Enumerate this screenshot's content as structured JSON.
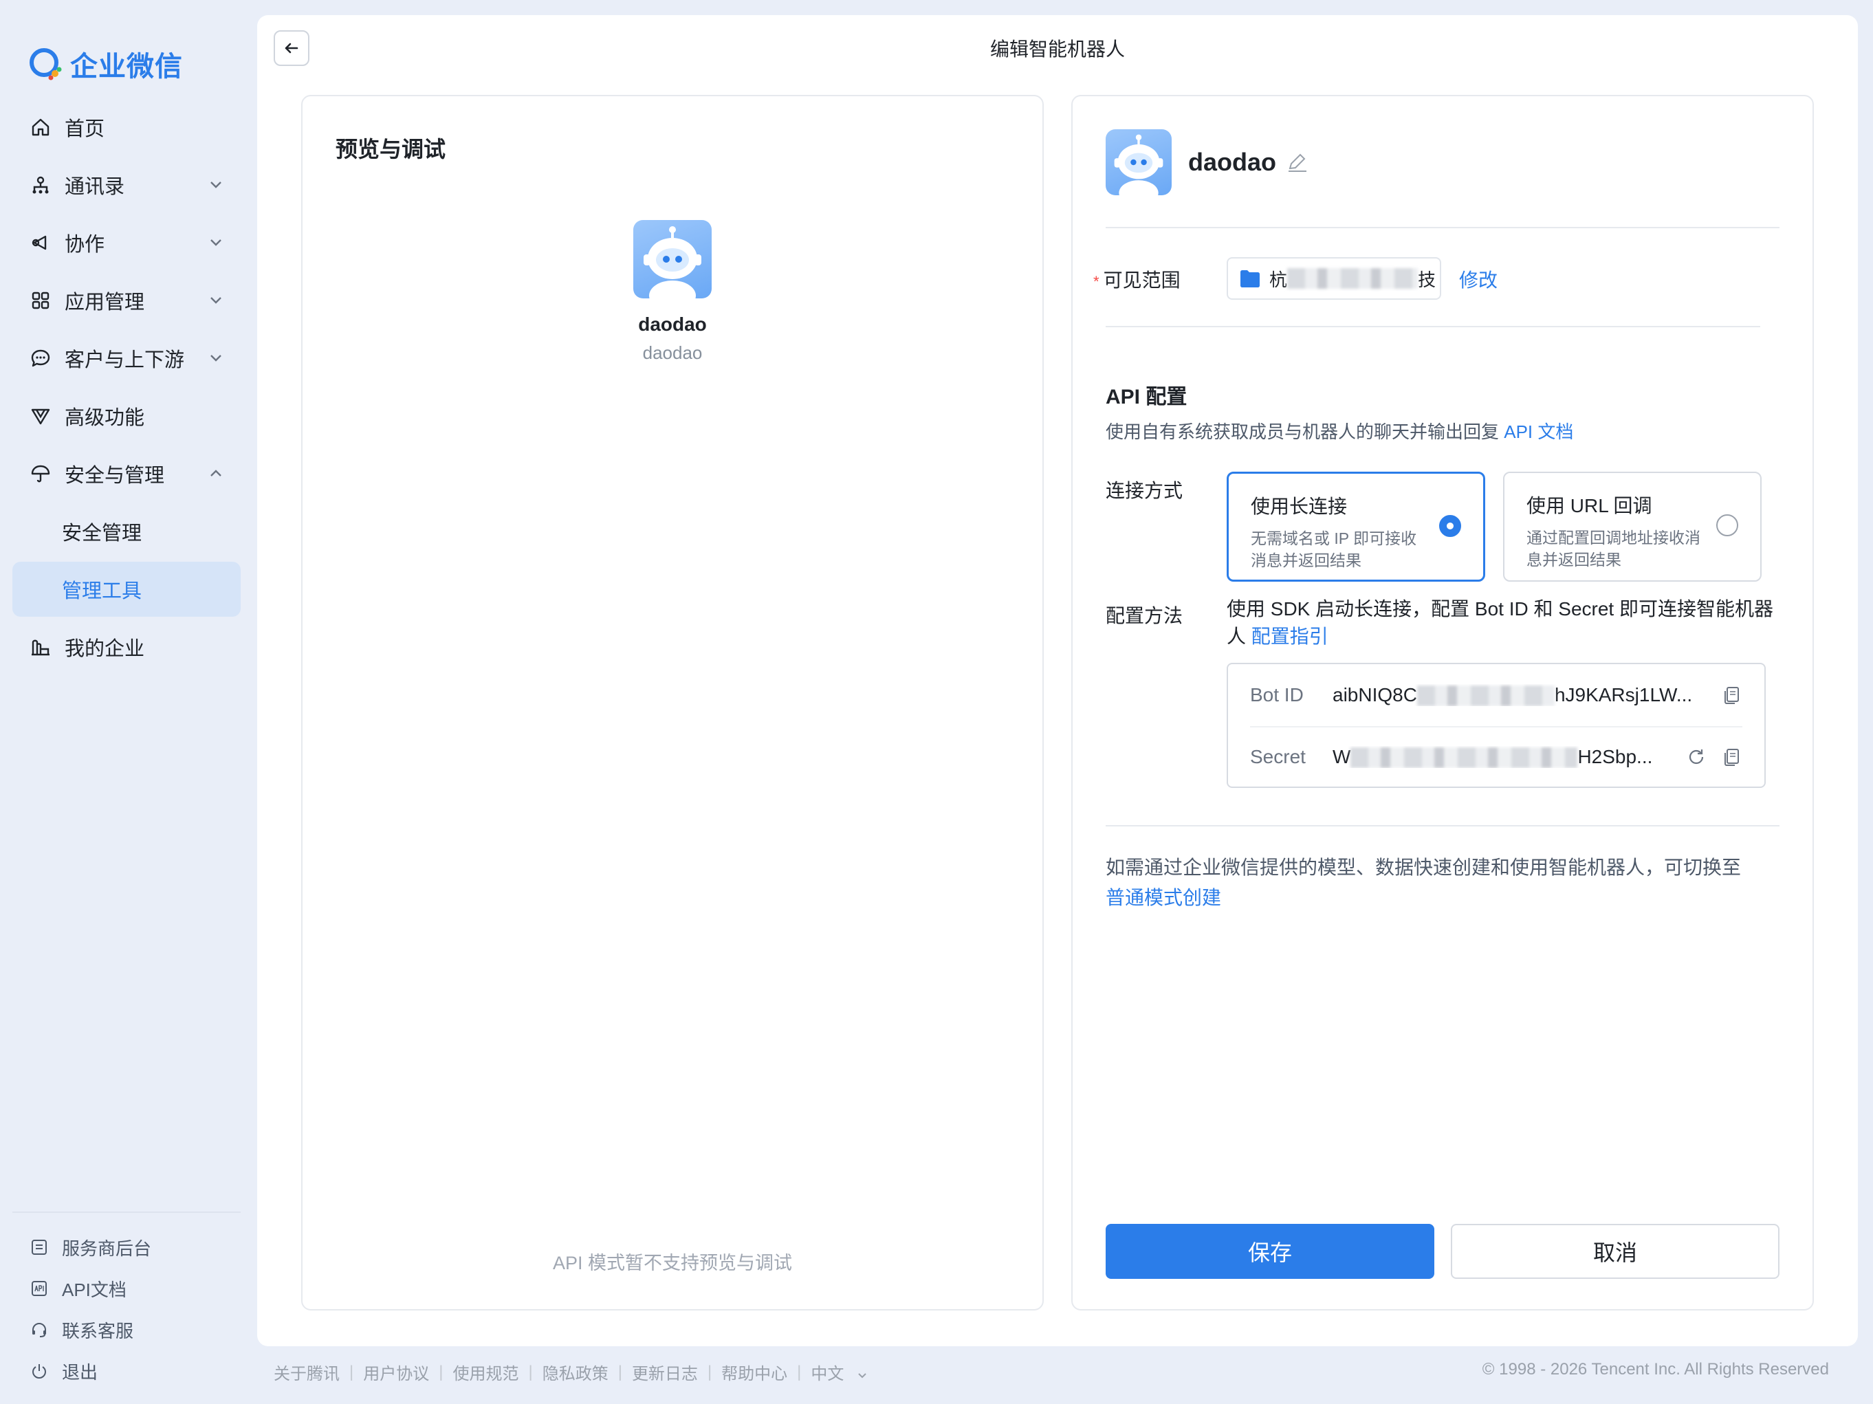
{
  "app": {
    "name": "企业微信",
    "brand_color": "#2b7de9"
  },
  "sidebar": {
    "items": [
      {
        "label": "首页",
        "icon": "home-icon"
      },
      {
        "label": "通讯录",
        "icon": "org-chart-icon",
        "expand": "chevron-down"
      },
      {
        "label": "协作",
        "icon": "collab-icon",
        "expand": "chevron-down"
      },
      {
        "label": "应用管理",
        "icon": "apps-grid-icon",
        "expand": "chevron-down"
      },
      {
        "label": "客户与上下游",
        "icon": "chat-bubble-icon",
        "expand": "chevron-down"
      },
      {
        "label": "高级功能",
        "icon": "advanced-icon"
      },
      {
        "label": "安全与管理",
        "icon": "umbrella-icon",
        "expand": "chevron-up"
      },
      {
        "label": "安全管理",
        "sub": true
      },
      {
        "label": "管理工具",
        "sub": true,
        "active": true
      },
      {
        "label": "我的企业",
        "icon": "buildings-icon"
      }
    ],
    "bottom": [
      {
        "label": "服务商后台",
        "icon": "provider-icon"
      },
      {
        "label": "API文档",
        "icon": "api-doc-icon"
      },
      {
        "label": "联系客服",
        "icon": "headset-icon"
      },
      {
        "label": "退出",
        "icon": "power-icon"
      }
    ]
  },
  "header": {
    "title": "编辑智能机器人"
  },
  "preview": {
    "title": "预览与调试",
    "bot_name": "daodao",
    "bot_sub": "daodao",
    "note": "API 模式暂不支持预览与调试"
  },
  "config": {
    "bot_name": "daodao",
    "scope_label": "可见范围",
    "scope_value_start": "杭",
    "scope_value_end": "技",
    "scope_edit": "修改",
    "api_title": "API 配置",
    "api_desc": "使用自有系统获取成员与机器人的聊天并输出回复",
    "api_doc_link": "API 文档",
    "connect_label": "连接方式",
    "options": [
      {
        "title": "使用长连接",
        "desc": "无需域名或 IP 即可接收消息并返回结果",
        "selected": true
      },
      {
        "title": "使用 URL 回调",
        "desc": "通过配置回调地址接收消息并返回结果",
        "selected": false
      }
    ],
    "method_label": "配置方法",
    "method_text": "使用 SDK 启动长连接，配置 Bot ID 和 Secret 即可连接智能机器人",
    "method_link": "配置指引",
    "bot_id_label": "Bot ID",
    "bot_id_start": "aibNIQ8C",
    "bot_id_end": "hJ9KARsj1LW...",
    "secret_label": "Secret",
    "secret_start": "W",
    "secret_end": "H2Sbp...",
    "switch_note": "如需通过企业微信提供的模型、数据快速创建和使用智能机器人，可切换至",
    "switch_link": "普通模式创建",
    "save": "保存",
    "cancel": "取消"
  },
  "footer": {
    "links": [
      "关于腾讯",
      "用户协议",
      "使用规范",
      "隐私政策",
      "更新日志",
      "帮助中心",
      "中文"
    ],
    "copyright": "© 1998 - 2026 Tencent Inc. All Rights Reserved"
  }
}
